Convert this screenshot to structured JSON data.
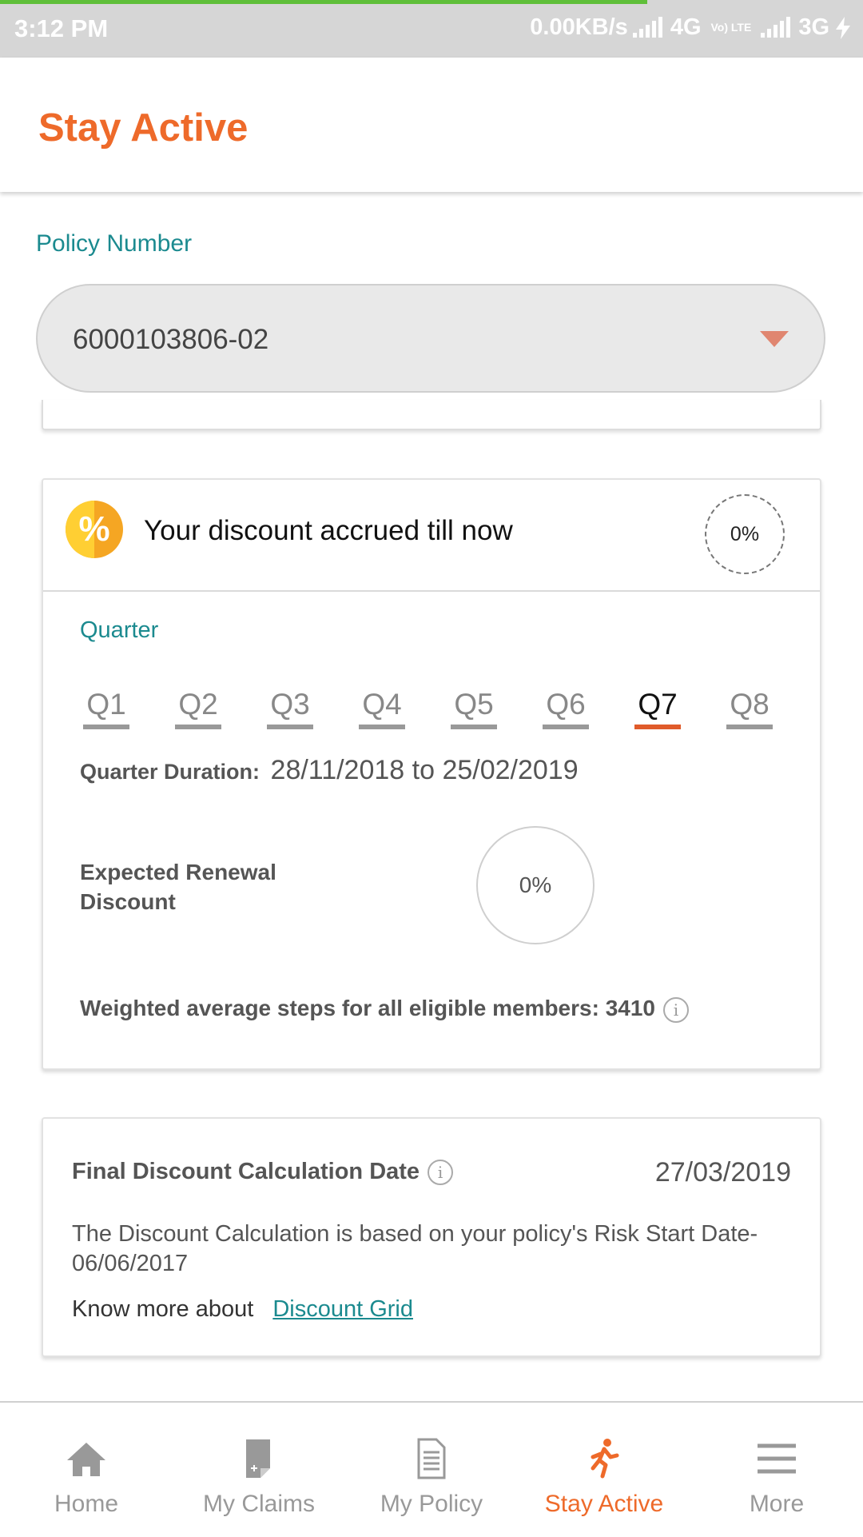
{
  "status_bar": {
    "time": "3:12 PM",
    "net_speed": "0.00KB/s",
    "network1": "4G",
    "volte": "Vo) LTE",
    "network2": "3G"
  },
  "app_bar": {
    "title": "Stay Active"
  },
  "policy": {
    "label": "Policy Number",
    "selected": "6000103806-02"
  },
  "discount_card": {
    "heading": "Your discount accrued till now",
    "accrued_percent": "0%",
    "quarter_label": "Quarter",
    "quarters": [
      "Q1",
      "Q2",
      "Q3",
      "Q4",
      "Q5",
      "Q6",
      "Q7",
      "Q8"
    ],
    "selected_quarter": "Q7",
    "duration_label": "Quarter Duration:",
    "duration_value": "28/11/2018 to 25/02/2019",
    "renewal_label": "Expected Renewal Discount",
    "renewal_percent": "0%",
    "steps_label": "Weighted average steps for all eligible members: 3410"
  },
  "final_card": {
    "label": "Final Discount Calculation Date",
    "date": "27/03/2019",
    "basis": "The Discount Calculation is based on your policy's Risk Start Date- 06/06/2017",
    "know_more": "Know more about",
    "link": "Discount Grid"
  },
  "bottom_nav": [
    {
      "label": "Home",
      "icon": "home-icon",
      "active": false
    },
    {
      "label": "My Claims",
      "icon": "claims-icon",
      "active": false
    },
    {
      "label": "My Policy",
      "icon": "policy-document-icon",
      "active": false
    },
    {
      "label": "Stay Active",
      "icon": "running-person-icon",
      "active": true
    },
    {
      "label": "More",
      "icon": "menu-icon",
      "active": false
    }
  ],
  "colors": {
    "brand_orange": "#ee6a2a",
    "teal": "#1b8a8f",
    "selected_underline": "#e05b2a"
  }
}
